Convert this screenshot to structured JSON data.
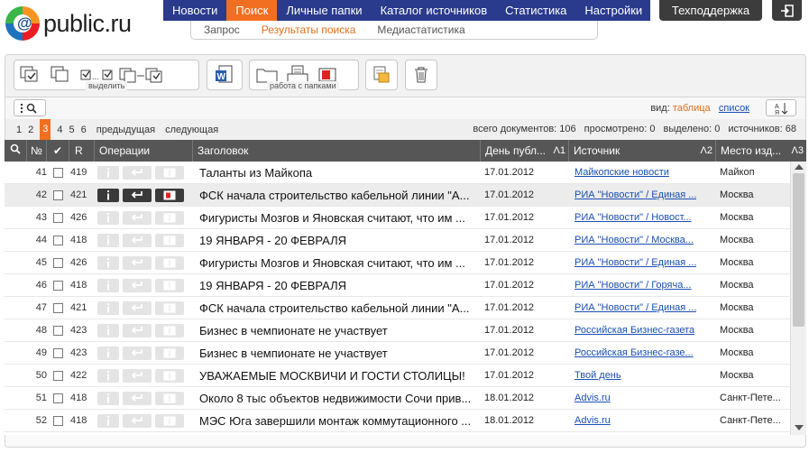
{
  "logo": {
    "text": "public.ru",
    "at": "@"
  },
  "nav": {
    "items": [
      {
        "label": "Новости",
        "active": false
      },
      {
        "label": "Поиск",
        "active": true
      },
      {
        "label": "Личные папки",
        "active": false
      },
      {
        "label": "Каталог источников",
        "active": false
      },
      {
        "label": "Статистика",
        "active": false
      },
      {
        "label": "Настройки",
        "active": false
      }
    ],
    "sub": [
      {
        "label": "Запрос",
        "active": false
      },
      {
        "label": "Результаты поиска",
        "active": true
      },
      {
        "label": "Медиастатистика",
        "active": false
      }
    ],
    "support": "Техподдержка"
  },
  "toolbar": {
    "select_label": "выделить",
    "folders_label": "работа с папками"
  },
  "view": {
    "label": "вид:",
    "table": "таблица",
    "list": "список"
  },
  "pagination": {
    "pages": [
      "1",
      "2",
      "3",
      "4",
      "5",
      "6"
    ],
    "current": "3",
    "prev": "предыдущая",
    "next": "следующая"
  },
  "stats": {
    "total": "всего документов: 106",
    "viewed": "просмотрено: 0",
    "selected": "выделено: 0",
    "sources": "источников: 68"
  },
  "columns": {
    "num": "№",
    "check": "✔",
    "r": "R",
    "ops": "Операции",
    "title": "Заголовок",
    "date": "День публ...",
    "date_sort": "Λ1",
    "source": "Источник",
    "source_sort": "Λ2",
    "place": "Место изд...",
    "place_sort": "Λ3"
  },
  "rows": [
    {
      "num": "41",
      "r": "419",
      "title": "Таланты из Майкопа",
      "date": "17.01.2012",
      "source": "Майкопские новости",
      "place": "Майкоп"
    },
    {
      "num": "42",
      "r": "421",
      "title": "ФСК начала строительство кабельной линии \"А...",
      "date": "17.01.2012",
      "source": "РИА \"Новости\" / Единая ...",
      "place": "Москва"
    },
    {
      "num": "43",
      "r": "426",
      "title": "Фигуристы Мозгов и Яновская считают, что им ...",
      "date": "17.01.2012",
      "source": "РИА \"Новости\" / Новост...",
      "place": "Москва"
    },
    {
      "num": "44",
      "r": "418",
      "title": "19 ЯНВАРЯ - 20 ФЕВРАЛЯ",
      "date": "17.01.2012",
      "source": "РИА \"Новости\" / Москва...",
      "place": "Москва"
    },
    {
      "num": "45",
      "r": "426",
      "title": "Фигуристы Мозгов и Яновская считают, что им ...",
      "date": "17.01.2012",
      "source": "РИА \"Новости\" / Единая ...",
      "place": "Москва"
    },
    {
      "num": "46",
      "r": "418",
      "title": "19 ЯНВАРЯ - 20 ФЕВРАЛЯ",
      "date": "17.01.2012",
      "source": "РИА \"Новости\" / Горяча...",
      "place": "Москва"
    },
    {
      "num": "47",
      "r": "421",
      "title": "ФСК начала строительство кабельной линии \"А...",
      "date": "17.01.2012",
      "source": "РИА \"Новости\" / Единая ...",
      "place": "Москва"
    },
    {
      "num": "48",
      "r": "423",
      "title": "Бизнес в чемпионате не участвует",
      "date": "17.01.2012",
      "source": "Российская Бизнес-газета",
      "place": "Москва"
    },
    {
      "num": "49",
      "r": "423",
      "title": "Бизнес в чемпионате не участвует",
      "date": "17.01.2012",
      "source": "Российская Бизнес-газе...",
      "place": "Москва"
    },
    {
      "num": "50",
      "r": "422",
      "title": "УВАЖАЕМЫЕ МОСКВИЧИ И ГОСТИ СТОЛИЦЫ!",
      "date": "17.01.2012",
      "source": "Твой день",
      "place": "Москва"
    },
    {
      "num": "51",
      "r": "418",
      "title": "Около 8 тыс объектов недвижимости Сочи прив...",
      "date": "18.01.2012",
      "source": "Advis.ru",
      "place": "Санкт-Пете..."
    },
    {
      "num": "52",
      "r": "418",
      "title": "МЭС Юга завершили монтаж коммутационного ...",
      "date": "18.01.2012",
      "source": "Advis.ru",
      "place": "Санкт-Пете..."
    }
  ],
  "highlighted_row": "42",
  "colors": {
    "nav_bg": "#2a3a8c",
    "accent": "#f26f21",
    "header_bg": "#565656",
    "link": "#1a4fb4"
  }
}
